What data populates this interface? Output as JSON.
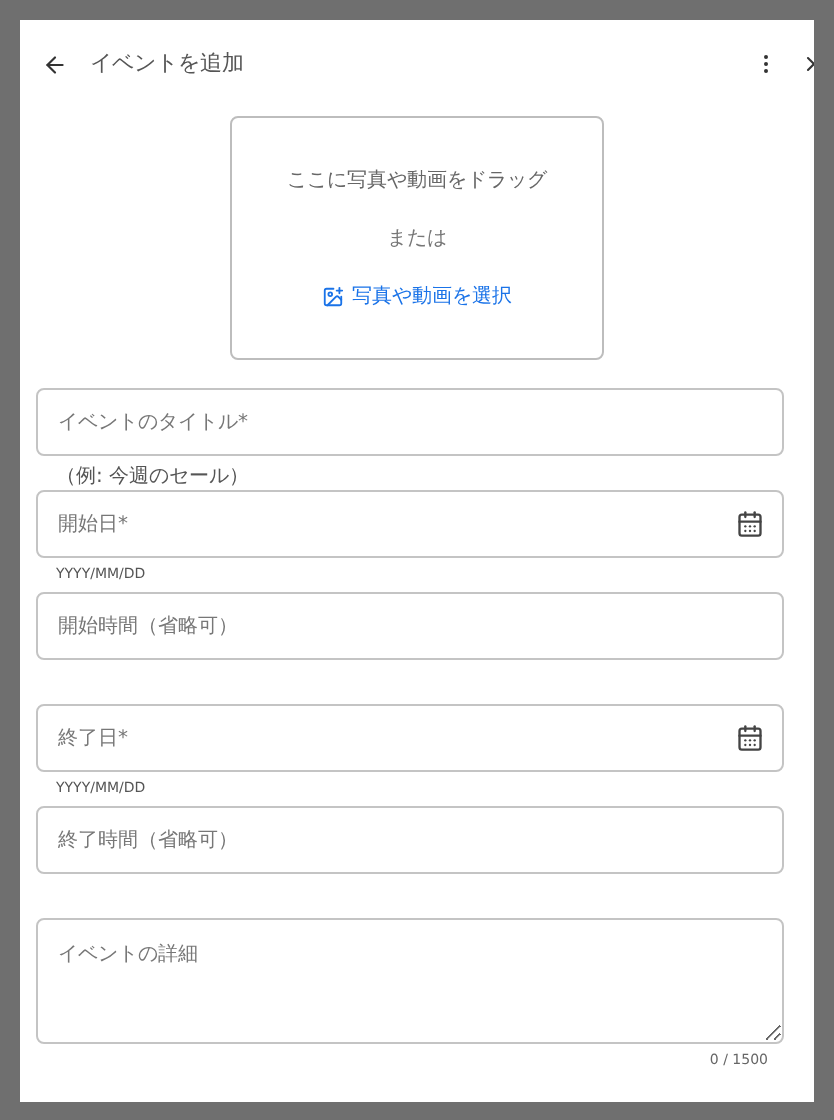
{
  "header": {
    "title": "イベントを追加"
  },
  "dropzone": {
    "hint": "ここに写真や動画をドラッグ",
    "or": "または",
    "select": "写真や動画を選択"
  },
  "fields": [
    {
      "kind": "text",
      "placeholder": "イベントのタイトル*",
      "helper": "（例: 今週のセール）"
    },
    {
      "kind": "date",
      "placeholder": "開始日*",
      "helper": "YYYY/MM/DD"
    },
    {
      "kind": "text",
      "placeholder": "開始時間（省略可）"
    },
    {
      "kind": "date",
      "placeholder": "終了日*",
      "helper": "YYYY/MM/DD"
    },
    {
      "kind": "text",
      "placeholder": "終了時間（省略可）"
    },
    {
      "kind": "textarea",
      "placeholder": "イベントの詳細",
      "counter": "0 / 1500"
    }
  ]
}
